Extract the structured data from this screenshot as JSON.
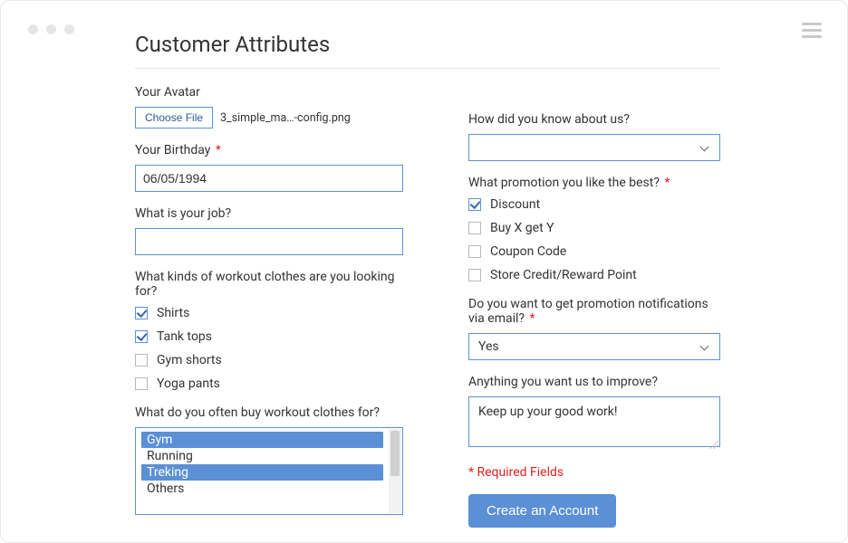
{
  "page": {
    "title": "Customer Attributes"
  },
  "left": {
    "avatar": {
      "label": "Your Avatar",
      "button": "Choose File",
      "filename": "3_simple_ma…-config.png"
    },
    "birthday": {
      "label": "Your Birthday",
      "required": true,
      "value": "06/05/1994"
    },
    "job": {
      "label": "What is your job?",
      "value": ""
    },
    "workout_kinds": {
      "label": "What kinds of workout clothes are you looking for?",
      "options": [
        {
          "label": "Shirts",
          "checked": true
        },
        {
          "label": "Tank tops",
          "checked": true
        },
        {
          "label": "Gym shorts",
          "checked": false
        },
        {
          "label": "Yoga pants",
          "checked": false
        }
      ]
    },
    "buy_for": {
      "label": "What do you often buy workout clothes for?",
      "options": [
        {
          "label": "Gym",
          "selected": true
        },
        {
          "label": "Running",
          "selected": false
        },
        {
          "label": "Treking",
          "selected": true
        },
        {
          "label": "Others",
          "selected": false
        }
      ]
    }
  },
  "right": {
    "referral": {
      "label": "How did you know about us?",
      "value": ""
    },
    "promotions": {
      "label": "What promotion you like the best?",
      "required": true,
      "options": [
        {
          "label": "Discount",
          "checked": true
        },
        {
          "label": "Buy X get Y",
          "checked": false
        },
        {
          "label": "Coupon Code",
          "checked": false
        },
        {
          "label": "Store Credit/Reward Point",
          "checked": false
        }
      ]
    },
    "notifications": {
      "label": "Do you want to get promotion notifications via email?",
      "required": true,
      "value": "Yes"
    },
    "improve": {
      "label": "Anything you want us to improve?",
      "value": "Keep up your good work!"
    },
    "required_note": "* Required Fields",
    "submit": "Create an Account"
  }
}
